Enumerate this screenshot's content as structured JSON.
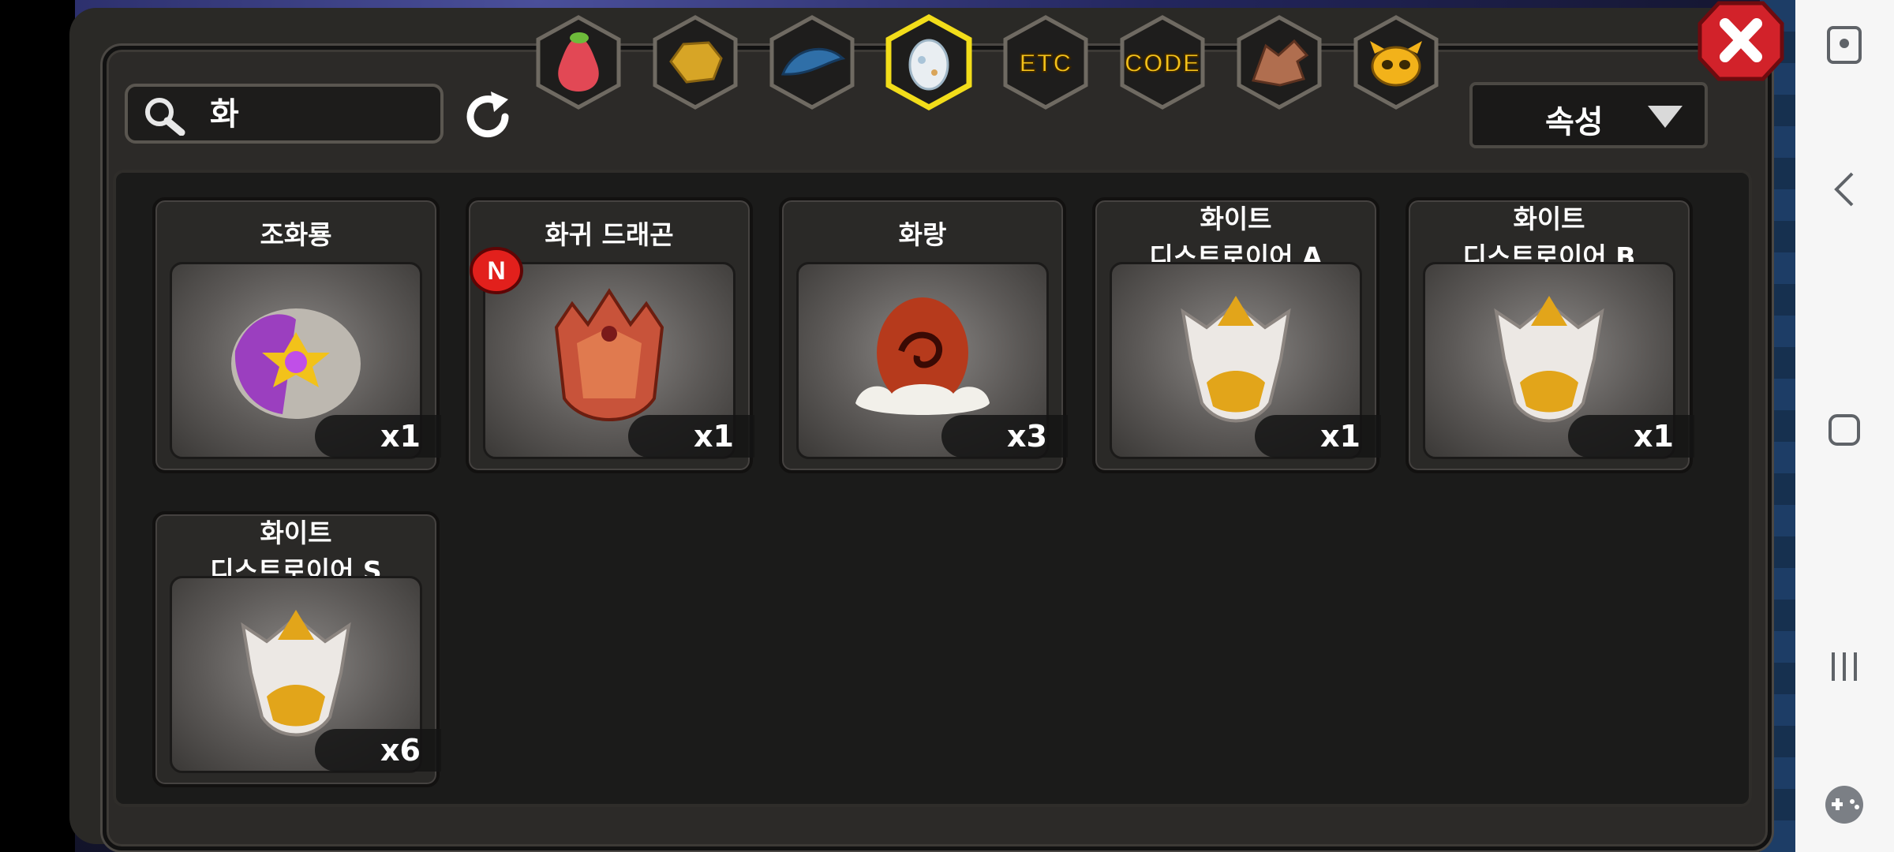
{
  "search": {
    "query": "화"
  },
  "tabs": [
    {
      "name": "fruit",
      "icon": "pear-icon"
    },
    {
      "name": "ore",
      "icon": "gold-ore-icon"
    },
    {
      "name": "scale",
      "icon": "dragon-scale-icon"
    },
    {
      "name": "egg",
      "icon": "egg-icon",
      "selected": true
    },
    {
      "name": "etc",
      "label": "ETC"
    },
    {
      "name": "code",
      "label": "CODE"
    },
    {
      "name": "dragon",
      "icon": "dragon-head-icon"
    },
    {
      "name": "mask",
      "icon": "mask-icon"
    }
  ],
  "sort": {
    "label": "속성"
  },
  "items": [
    {
      "name": "조화룡",
      "qty": "x1",
      "icon": "harmony-dragon-egg-icon"
    },
    {
      "name": "화귀 드래곤",
      "qty": "x1",
      "icon": "fire-demon-dragon-egg-icon",
      "badge": "N"
    },
    {
      "name": "화랑",
      "qty": "x3",
      "icon": "hwarang-egg-icon"
    },
    {
      "name": "화이트\n디스트로이어 A",
      "qty": "x1",
      "icon": "white-destroyer-egg-icon"
    },
    {
      "name": "화이트\n디스트로이어 B",
      "qty": "x1",
      "icon": "white-destroyer-egg-icon"
    },
    {
      "name": "화이트\n디스트로이어 S",
      "qty": "x6",
      "icon": "white-destroyer-egg-icon"
    }
  ],
  "colors": {
    "accent": "#f4c21a",
    "panel": "#2c2a28",
    "close": "#d2222a"
  }
}
